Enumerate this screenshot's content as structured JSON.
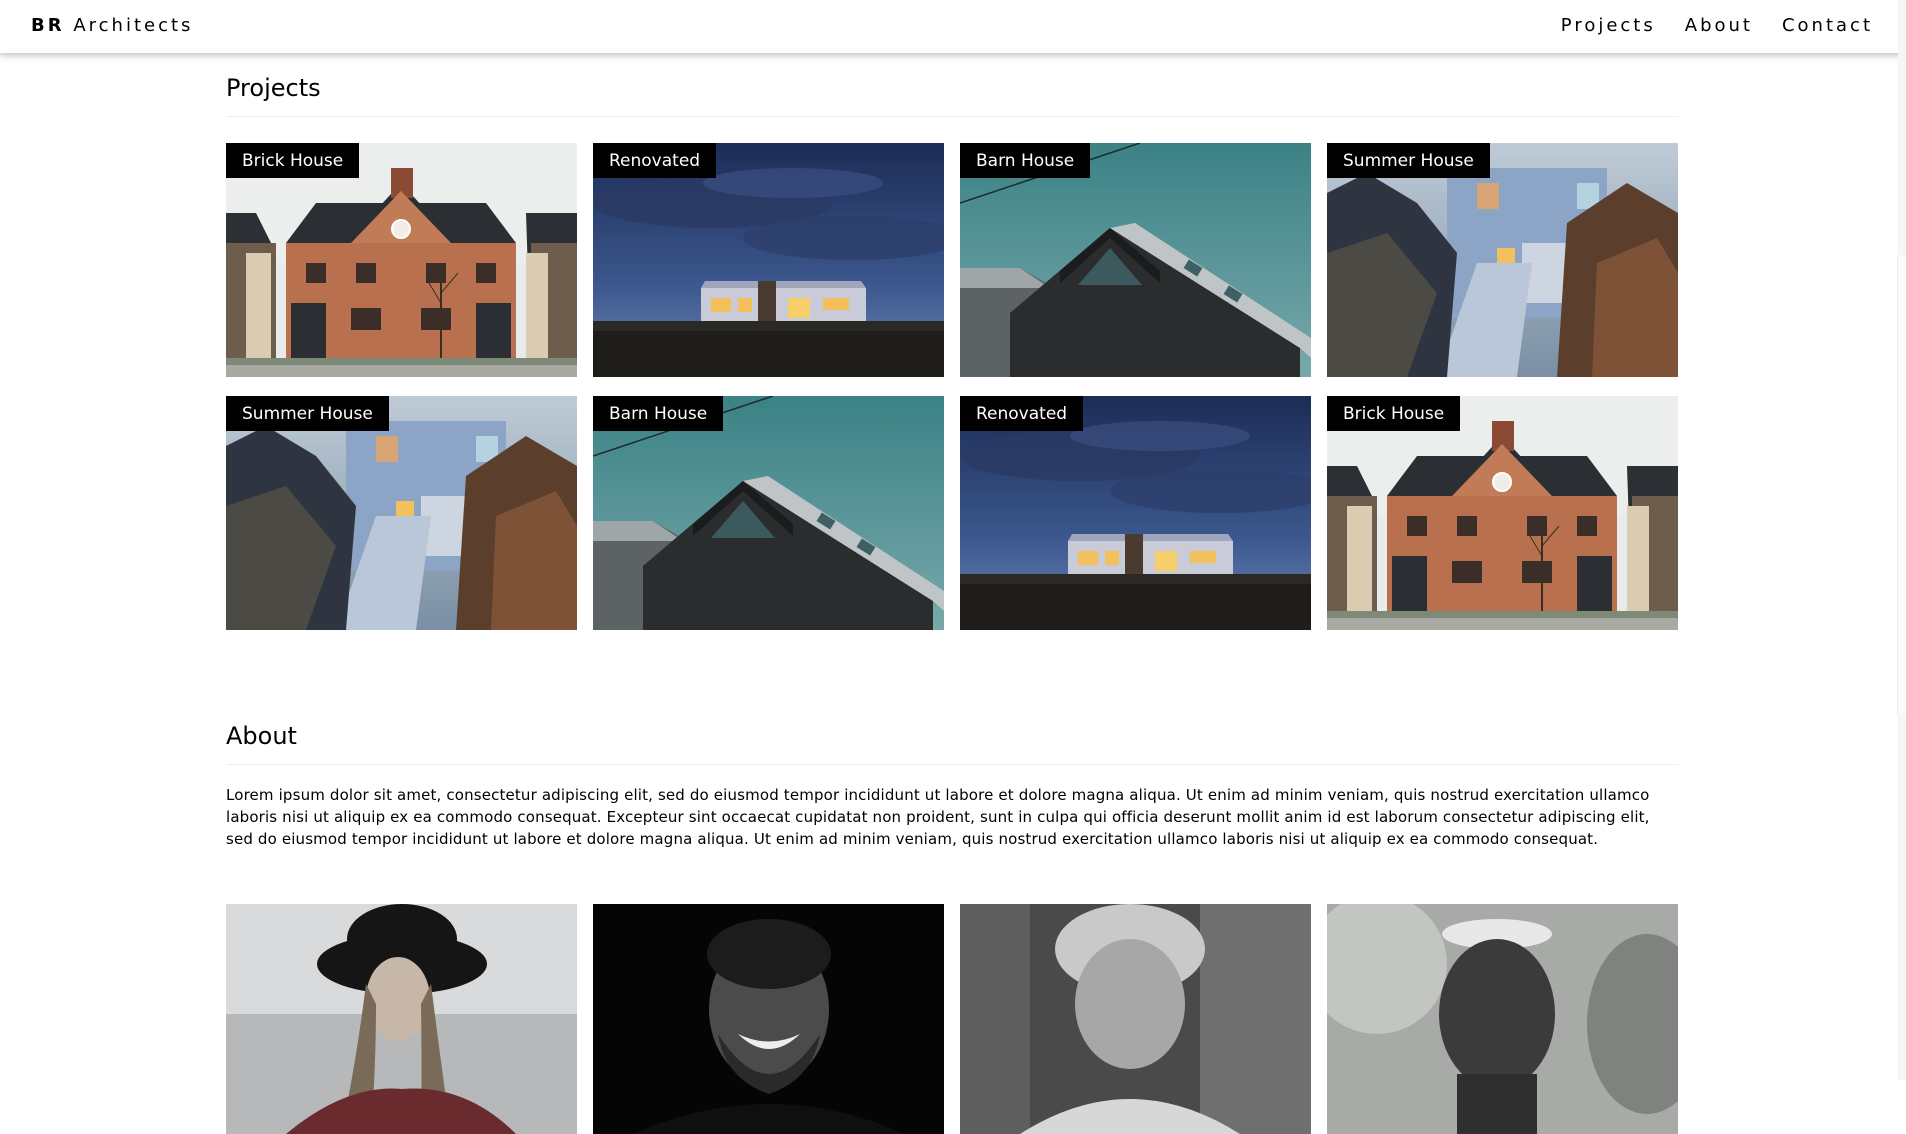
{
  "nav": {
    "brand_bold": "BR",
    "brand_rest": "Architects",
    "links": [
      "Projects",
      "About",
      "Contact"
    ]
  },
  "projects": {
    "title": "Projects",
    "cards": [
      {
        "label": "Brick House",
        "image": "brick-house-photo"
      },
      {
        "label": "Renovated",
        "image": "renovated-house-photo"
      },
      {
        "label": "Barn House",
        "image": "barn-house-photo"
      },
      {
        "label": "Summer House",
        "image": "summer-house-photo"
      },
      {
        "label": "Summer House",
        "image": "summer-house-photo"
      },
      {
        "label": "Barn House",
        "image": "barn-house-photo"
      },
      {
        "label": "Renovated",
        "image": "renovated-house-photo"
      },
      {
        "label": "Brick House",
        "image": "brick-house-photo"
      }
    ]
  },
  "about": {
    "title": "About",
    "text": "Lorem ipsum dolor sit amet, consectetur adipiscing elit, sed do eiusmod tempor incididunt ut labore et dolore magna aliqua. Ut enim ad minim veniam, quis nostrud exercitation ullamco laboris nisi ut aliquip ex ea commodo consequat. Excepteur sint occaecat cupidatat non proident, sunt in culpa qui officia deserunt mollit anim id est laborum consectetur adipiscing elit, sed do eiusmod tempor incididunt ut labore et dolore magna aliqua. Ut enim ad minim veniam, quis nostrud exercitation ullamco laboris nisi ut aliquip ex ea commodo consequat."
  },
  "team": [
    {
      "image": "woman-in-hat-portrait"
    },
    {
      "image": "smiling-bearded-man-portrait"
    },
    {
      "image": "grey-haired-man-portrait"
    },
    {
      "image": "young-man-portrait"
    }
  ]
}
